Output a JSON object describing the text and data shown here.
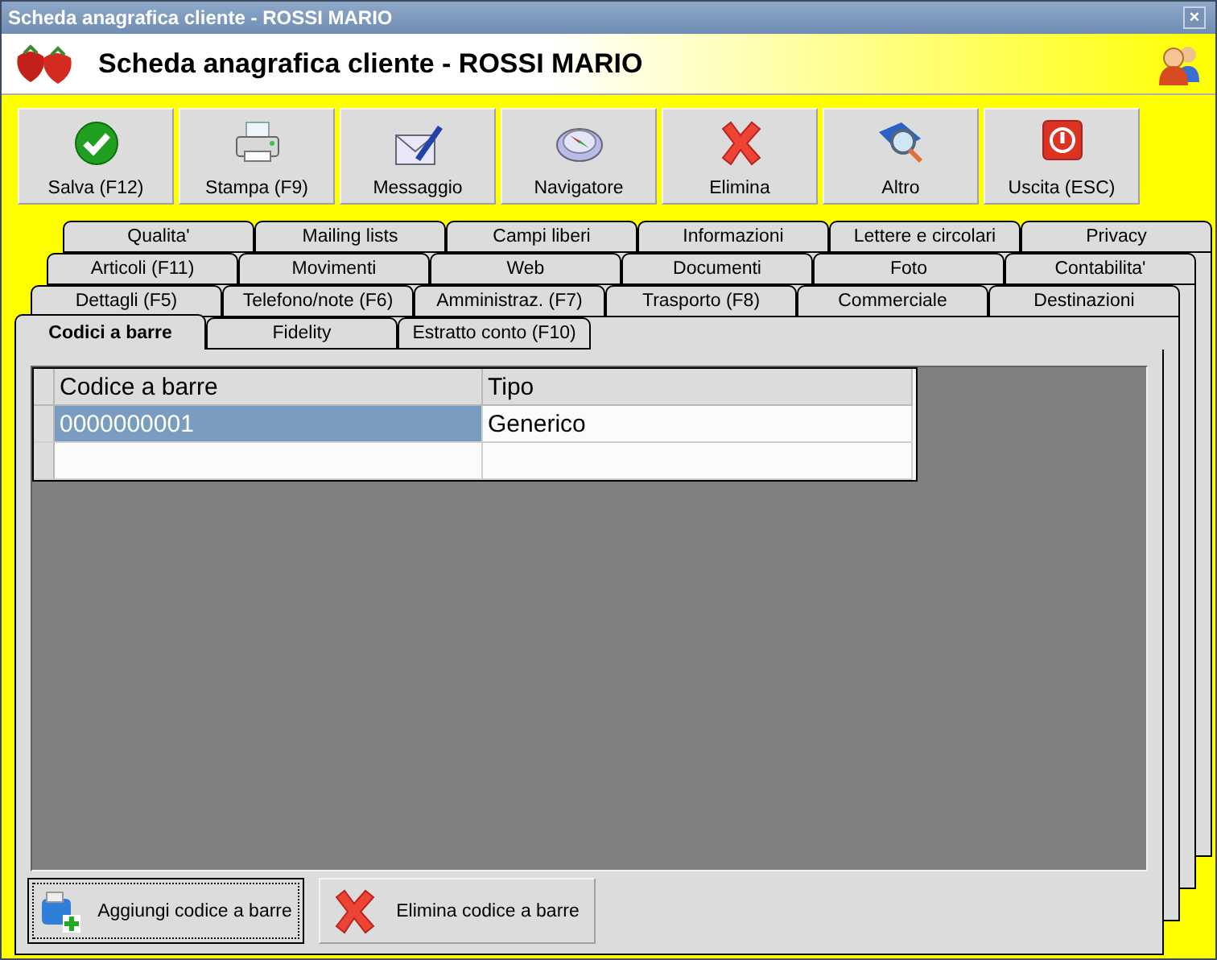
{
  "window": {
    "title": "Scheda anagrafica cliente - ROSSI MARIO",
    "close": "×"
  },
  "header": {
    "title": "Scheda anagrafica cliente - ROSSI MARIO"
  },
  "toolbar": [
    {
      "label": "Salva (F12)",
      "kind": "save"
    },
    {
      "label": "Stampa (F9)",
      "kind": "print"
    },
    {
      "label": "Messaggio",
      "kind": "message"
    },
    {
      "label": "Navigatore",
      "kind": "navigator"
    },
    {
      "label": "Elimina",
      "kind": "delete"
    },
    {
      "label": "Altro",
      "kind": "more"
    },
    {
      "label": "Uscita (ESC)",
      "kind": "exit"
    }
  ],
  "tab_rows": [
    [
      {
        "label": "Qualita'",
        "selected": false
      },
      {
        "label": "Mailing lists",
        "selected": false
      },
      {
        "label": "Campi liberi",
        "selected": false
      },
      {
        "label": "Informazioni",
        "selected": false
      },
      {
        "label": "Lettere e circolari",
        "selected": false
      },
      {
        "label": "Privacy",
        "selected": false
      }
    ],
    [
      {
        "label": "Articoli (F11)",
        "selected": false
      },
      {
        "label": "Movimenti",
        "selected": false
      },
      {
        "label": "Web",
        "selected": false
      },
      {
        "label": "Documenti",
        "selected": false
      },
      {
        "label": "Foto",
        "selected": false
      },
      {
        "label": "Contabilita'",
        "selected": false
      }
    ],
    [
      {
        "label": "Dettagli (F5)",
        "selected": false
      },
      {
        "label": "Telefono/note (F6)",
        "selected": false
      },
      {
        "label": "Amministraz. (F7)",
        "selected": false
      },
      {
        "label": "Trasporto (F8)",
        "selected": false
      },
      {
        "label": "Commerciale",
        "selected": false
      },
      {
        "label": "Destinazioni",
        "selected": false
      }
    ],
    [
      {
        "label": "Codici a barre",
        "selected": true
      },
      {
        "label": "Fidelity",
        "selected": false
      },
      {
        "label": "Estratto conto (F10)",
        "selected": false
      }
    ]
  ],
  "grid": {
    "columns": [
      "Codice a barre",
      "Tipo"
    ],
    "rows": [
      {
        "cells": [
          "0000000001",
          "Generico"
        ],
        "selected": true
      }
    ]
  },
  "actions": [
    {
      "label": "Aggiungi codice a barre",
      "kind": "add",
      "focused": true
    },
    {
      "label": "Elimina codice a barre",
      "kind": "delete",
      "focused": false
    }
  ]
}
